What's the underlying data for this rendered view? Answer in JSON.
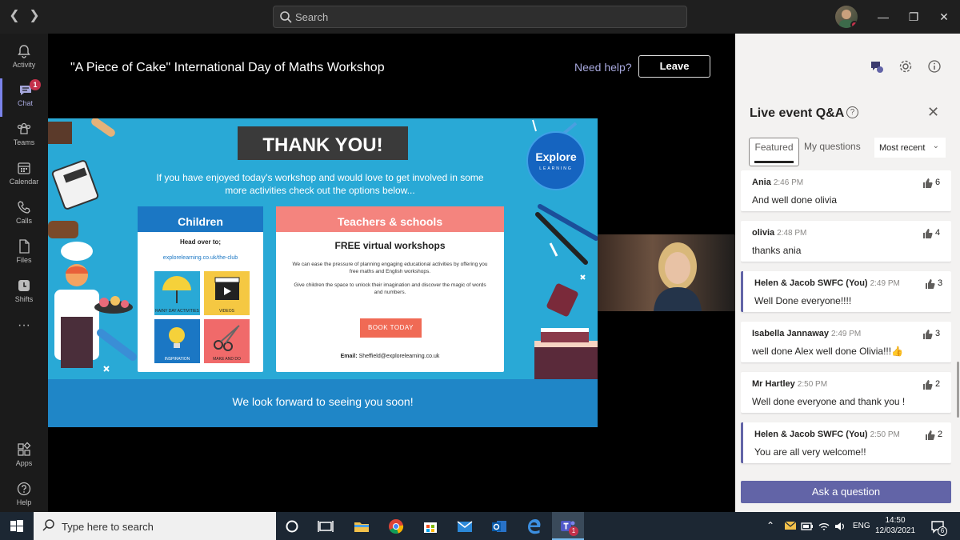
{
  "titlebar": {
    "search_placeholder": "Search"
  },
  "rail": {
    "items": [
      {
        "label": "Activity",
        "icon": "bell-icon"
      },
      {
        "label": "Chat",
        "icon": "chat-icon",
        "badge": "1"
      },
      {
        "label": "Teams",
        "icon": "teams-icon"
      },
      {
        "label": "Calendar",
        "icon": "calendar-icon"
      },
      {
        "label": "Calls",
        "icon": "phone-icon"
      },
      {
        "label": "Files",
        "icon": "file-icon"
      },
      {
        "label": "Shifts",
        "icon": "clock-icon"
      },
      {
        "label": "Apps",
        "icon": "apps-icon"
      },
      {
        "label": "Help",
        "icon": "help-icon"
      }
    ],
    "more": "···"
  },
  "event": {
    "title": "\"A Piece of Cake\" International Day of Maths Workshop",
    "need_help": "Need help?",
    "leave": "Leave"
  },
  "slide": {
    "thank_you": "THANK YOU!",
    "intro_line1": "If you have enjoyed today's workshop and would love to get involved in some",
    "intro_line2": "more activities check out the options below...",
    "logo_name": "Explore",
    "logo_sub": "LEARNING",
    "children": {
      "header": "Children",
      "head_over": "Head over to;",
      "link": "explorelearning.co.uk/the-club",
      "tiles": [
        "RAINY DAY ACTIVITIES",
        "VIDEOS",
        "INSPIRATION",
        "MAKE AND DO"
      ]
    },
    "teachers": {
      "header": "Teachers & schools",
      "subtitle": "FREE virtual workshops",
      "para1": "We can ease the pressure of planning engaging educational activities by offering you free maths and English workshops.",
      "para2": "Give children the space to unlock their imagination and discover the magic of words and numbers.",
      "button": "BOOK TODAY",
      "email_label": "Email:",
      "email": "Sheffield@explorelearning.co.uk"
    },
    "footer": "We look forward to seeing you soon!"
  },
  "qa": {
    "title": "Live event Q&A",
    "tabs": {
      "featured": "Featured",
      "mine": "My questions"
    },
    "sort": "Most recent",
    "questions": [
      {
        "author": "Ania",
        "time": "2:46 PM",
        "message": "And well done olivia",
        "likes": "6",
        "mine": false
      },
      {
        "author": "olivia",
        "time": "2:48 PM",
        "message": "thanks ania",
        "likes": "4",
        "mine": false
      },
      {
        "author": "Helen & Jacob SWFC (You)",
        "time": "2:49 PM",
        "message": "Well Done everyone!!!!",
        "likes": "3",
        "mine": true
      },
      {
        "author": "Isabella Jannaway",
        "time": "2:49 PM",
        "message": "well done Alex well done Olivia!!!👍",
        "likes": "3",
        "mine": false
      },
      {
        "author": "Mr Hartley",
        "time": "2:50 PM",
        "message": "Well done everyone and thank you !",
        "likes": "2",
        "mine": false
      },
      {
        "author": "Helen & Jacob SWFC (You)",
        "time": "2:50 PM",
        "message": "You are all very welcome!!",
        "likes": "2",
        "mine": true
      }
    ],
    "ask_button": "Ask a question"
  },
  "taskbar": {
    "search_placeholder": "Type here to search",
    "language": "ENG",
    "time": "14:50",
    "date": "12/03/2021",
    "notifications": "6",
    "teams_badge": "1"
  },
  "colors": {
    "accent": "#6264a7",
    "slide_bg": "#29a9d6",
    "badge": "#c4314b"
  }
}
